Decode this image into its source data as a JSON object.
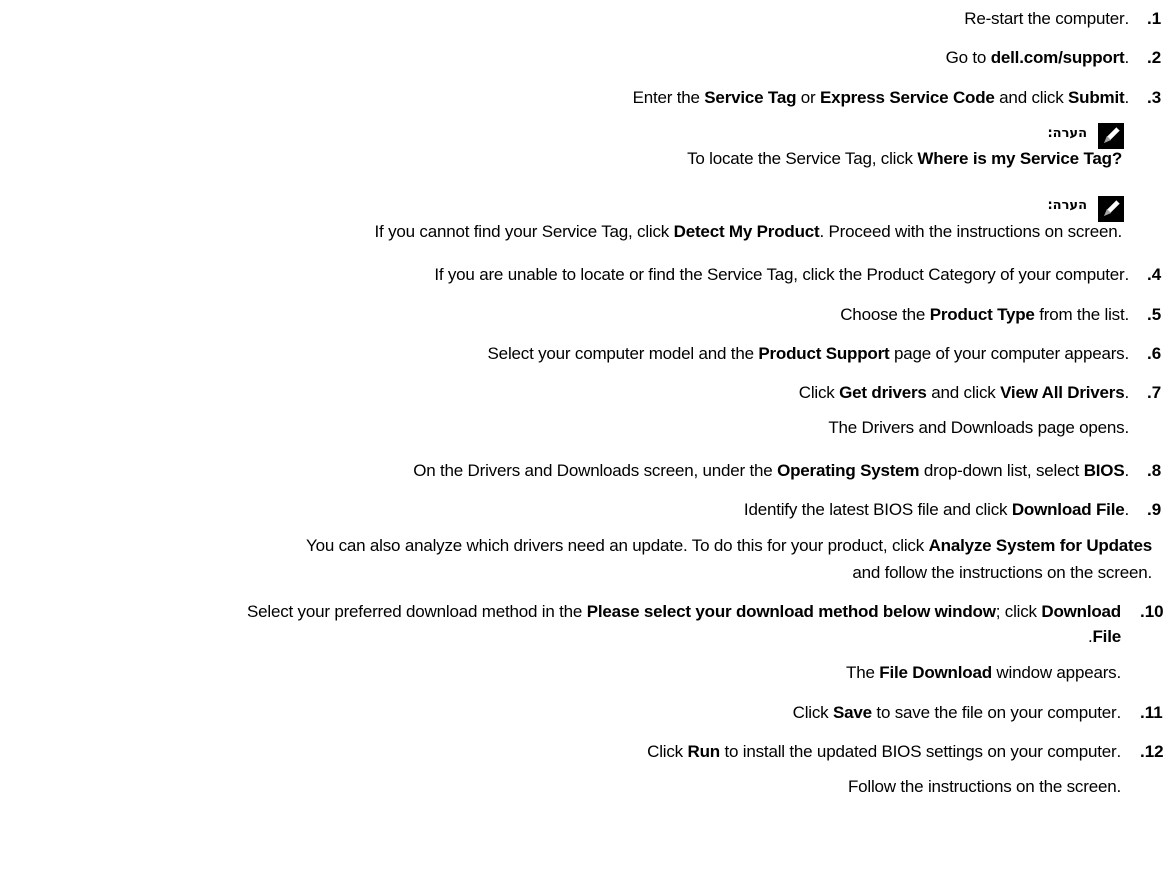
{
  "steps": [
    {
      "num": ".1",
      "parts": [
        ".Re-start the computer"
      ]
    },
    {
      "num": ".2",
      "parts": [
        ".Go to ",
        "dell.com/support"
      ]
    },
    {
      "num": ".3",
      "parts": [
        ".Enter the ",
        "Service Tag",
        " or ",
        "Express Service Code",
        " and click ",
        "Submit"
      ]
    },
    {
      "num": ".4",
      "parts": [
        ".If you are unable to locate or find the Service Tag, click the Product Category of your computer"
      ]
    },
    {
      "num": ".5",
      "parts": [
        ".Choose the ",
        "Product Type",
        " from the list"
      ]
    },
    {
      "num": ".6",
      "parts": [
        ".Select your computer model and the ",
        "Product Support",
        " page of your computer appears"
      ]
    },
    {
      "num": ".7",
      "parts": [
        ".Click ",
        "Get drivers",
        " and click ",
        "View All Drivers"
      ]
    },
    {
      "num": ".8",
      "parts": [
        ".On the Drivers and Downloads screen, under the ",
        "Operating System",
        " drop-down list, select ",
        "BIOS"
      ]
    },
    {
      "num": ".9",
      "parts": [
        ".Identify the latest BIOS file and click ",
        "Download File"
      ]
    },
    {
      "num": ".10",
      "parts": [
        "Select your preferred download method in the ",
        "Please select your download method below window",
        "; click ",
        "Download"
      ]
    },
    {
      "num": ".11",
      "parts": [
        ".Click ",
        "Save",
        " to save the file on your computer"
      ]
    },
    {
      "num": ".12",
      "parts": [
        ".Click ",
        "Run",
        " to install the updated BIOS settings on your computer"
      ]
    }
  ],
  "notes": [
    {
      "label": "הערה:",
      "parts": [
        "?",
        "To locate the Service Tag, click ",
        "Where is my Service Tag"
      ]
    },
    {
      "label": "הערה:",
      "parts": [
        ".If you cannot find your Service Tag, click ",
        "Detect My Product",
        ". Proceed with the instructions on screen"
      ]
    }
  ],
  "sublines": {
    "step7": ".The Drivers and Downloads page opens",
    "step9a": [
      "You can also analyze which drivers need an update. To do this for your product, click ",
      "Analyze System for Updates"
    ],
    "step9b": ".and follow the instructions on the screen",
    "step10b": [
      "File",
      "."
    ],
    "step10c": [
      ".The ",
      "File Download",
      " window appears"
    ],
    "step12": ".Follow the instructions on the screen"
  }
}
